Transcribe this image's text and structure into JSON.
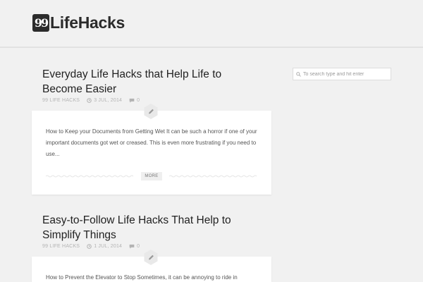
{
  "site": {
    "logo_mark": "99",
    "name": "LifeHacks"
  },
  "search": {
    "placeholder": "To search type and hit enter"
  },
  "posts": [
    {
      "title": "Everyday Life Hacks that Help Life to Become Easier",
      "author": "99 LIFE HACKS",
      "date": "3 JUL, 2014",
      "comments": "0",
      "excerpt": "How to Keep your Documents from Getting Wet It can be such a horror if one of your important documents got wet or creased. This is even more frustrating if you need to use...",
      "more_label": "MORE"
    },
    {
      "title": "Easy-to-Follow Life Hacks That Help to Simplify Things",
      "author": "99 LIFE HACKS",
      "date": "1 JUL, 2014",
      "comments": "0",
      "excerpt": "How to Prevent the Elevator to Stop Sometimes, it can be annoying to ride in"
    }
  ],
  "colors": {
    "background": "#f1f1f1",
    "card": "#ffffff",
    "meta": "#b3b3b3",
    "title": "#222222"
  },
  "icons": {
    "author": "none",
    "date": "clock-icon",
    "comments": "comment-icon",
    "format": "pencil-icon",
    "search": "search-icon"
  }
}
